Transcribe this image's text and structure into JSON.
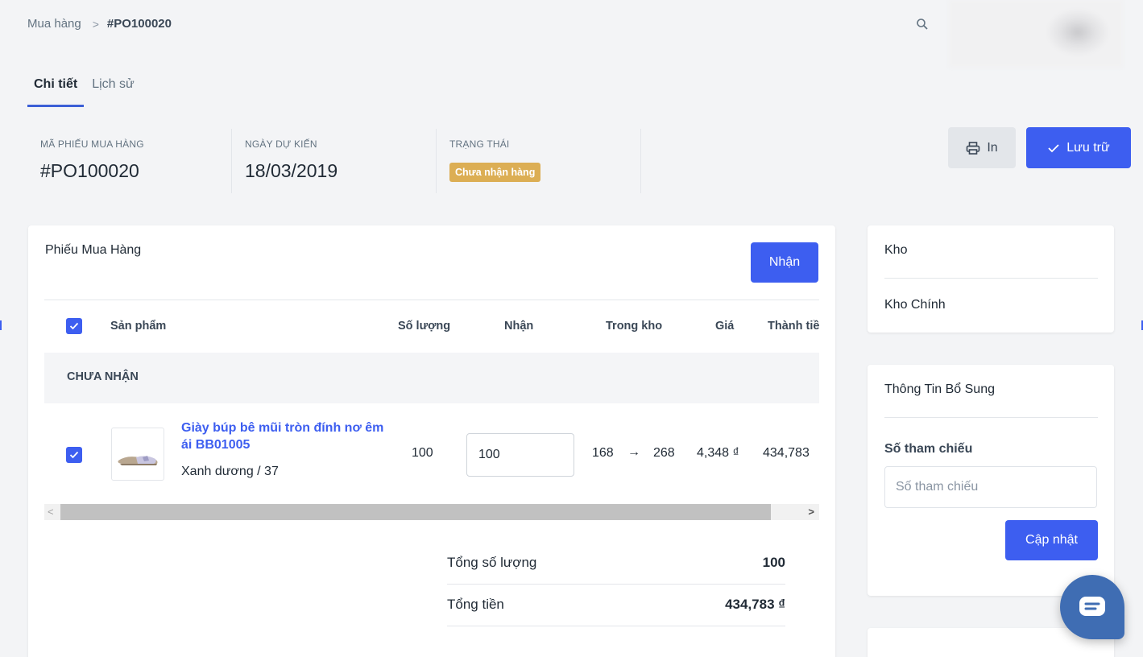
{
  "breadcrumb": {
    "parent": "Mua hàng",
    "separator": ">",
    "current": "#PO100020"
  },
  "tabs": [
    {
      "label": "Chi tiết",
      "active": true
    },
    {
      "label": "Lịch sử",
      "active": false
    }
  ],
  "meta": {
    "po_code_label": "MÃ PHIẾU MUA HÀNG",
    "po_code": "#PO100020",
    "due_date_label": "NGÀY DỰ KIẾN",
    "due_date": "18/03/2019",
    "status_label": "TRẠNG THÁI",
    "status": "Chưa nhận hàng"
  },
  "actions": {
    "print_label": "In",
    "save_label": "Lưu trữ"
  },
  "order_card": {
    "title": "Phiếu Mua Hàng",
    "receive_button": "Nhận",
    "columns": [
      "Sản phẩm",
      "Số lượng",
      "Nhận",
      "Trong kho",
      "Giá",
      "Thành tiề"
    ],
    "group_label": "CHƯA NHẬN",
    "item": {
      "name": "Giày búp bê mũi tròn đính nơ êm ái BB01005",
      "variant": "Xanh dương / 37",
      "quantity": "100",
      "receive_value": "100",
      "stock_from": "168",
      "stock_arrow": "→",
      "stock_to": "268",
      "price": "4,348 ₫",
      "total": "434,783"
    },
    "totals": {
      "qty_label": "Tổng số lượng",
      "qty_value": "100",
      "amount_label": "Tổng tiền",
      "amount_value": "434,783 ₫"
    }
  },
  "warehouse_card": {
    "title": "Kho",
    "value": "Kho Chính"
  },
  "extra_card": {
    "title": "Thông Tin Bổ Sung",
    "ref_label": "Số tham chiếu",
    "ref_placeholder": "Số tham chiếu",
    "update_button": "Cập nhật"
  },
  "colors": {
    "primary": "#3d5ef0",
    "status_badge": "#dcae54",
    "chat": "#3f6db3"
  },
  "icons": [
    "search-icon",
    "printer-icon",
    "check-icon",
    "chat-icon"
  ]
}
